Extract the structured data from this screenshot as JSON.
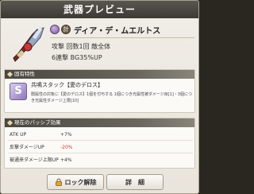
{
  "window": {
    "title": "武器プレビュー"
  },
  "weapon": {
    "element_icon": "dark-element-icon",
    "rank_badge": "計",
    "name": "ディア・デ・ムエルトス",
    "type_line": "攻撃 回数1回 敵全体",
    "effect_line": "6連撃 BG35%UP"
  },
  "unique_trait": {
    "header": "固有特性",
    "icon_glyph": "S",
    "skill_name": "共鳴スタック【愛のデロス】",
    "skill_desc": "闇属性の対象に【愛のデロス】1個を付与する 1個につき光属性被ダメージ目[1]・3個につき光属性ダメージ上限[10]"
  },
  "passive": {
    "header": "現在のパッシブ効果",
    "rows": [
      {
        "label": "ATK UP",
        "value": "+7%",
        "negative": false
      },
      {
        "label": "反撃ダメージUP",
        "value": "-20%",
        "negative": true
      },
      {
        "label": "被通来ダメージ上限UP",
        "value": "+4%",
        "negative": false
      }
    ]
  },
  "buttons": {
    "lock_label": "ロック解除",
    "detail_label": "詳　細"
  }
}
